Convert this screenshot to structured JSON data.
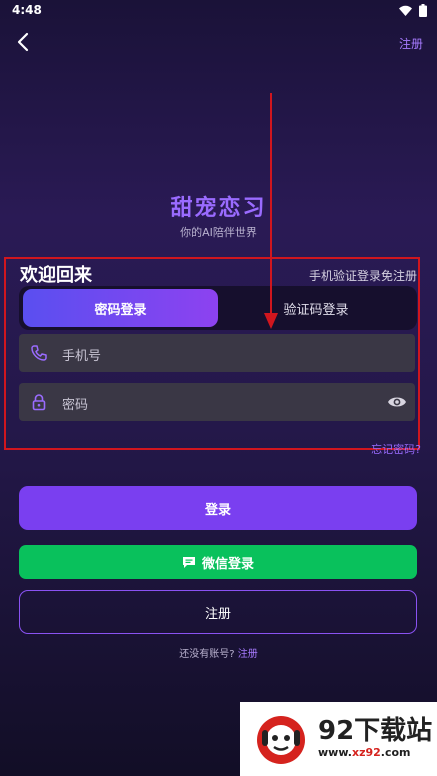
{
  "status_bar": {
    "time": "4:48"
  },
  "header": {
    "register_label": "注册"
  },
  "brand": {
    "title": "甜宠恋习",
    "subtitle": "你的AI陪伴世界"
  },
  "form": {
    "welcome": "欢迎回来",
    "sms_free": "手机验证登录免注册",
    "tabs": [
      {
        "label": "密码登录",
        "active": true
      },
      {
        "label": "验证码登录",
        "active": false
      }
    ],
    "phone_placeholder": "手机号",
    "password_placeholder": "密码",
    "forgot_password": "忘记密码?"
  },
  "buttons": {
    "login": "登录",
    "wechat_login": "微信登录",
    "register": "注册"
  },
  "footer": {
    "no_account": "还没有账号?",
    "register_link": "注册"
  },
  "watermark": {
    "title": "92下载站",
    "url_prefix": "www.",
    "url_brand": "xz92",
    "url_suffix": ".com"
  },
  "colors": {
    "accent_purple": "#7a3ff0",
    "wechat_green": "#09c15c",
    "annotation_red": "#d0161e"
  },
  "icons": [
    "back-arrow-icon",
    "wifi-icon",
    "battery-icon",
    "phone-icon",
    "lock-icon",
    "eye-icon",
    "wechat-chat-icon"
  ]
}
